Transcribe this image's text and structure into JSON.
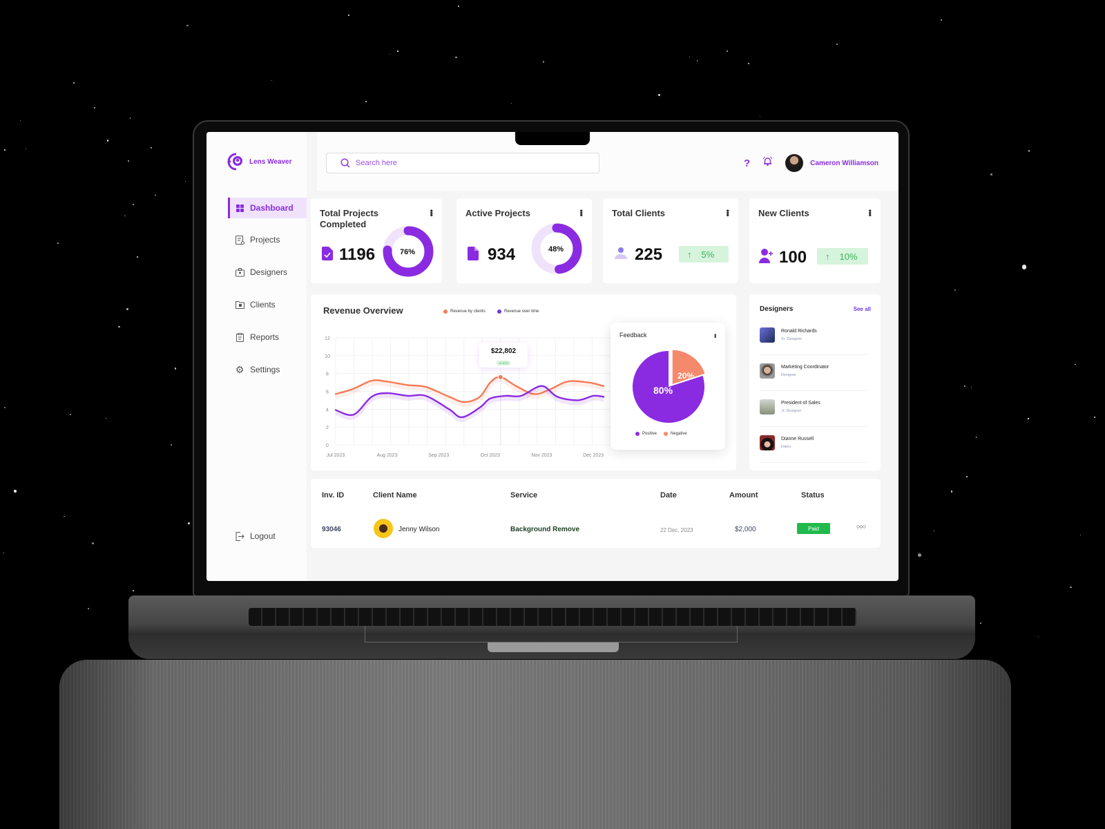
{
  "app": {
    "name": "Lens Weaver"
  },
  "header": {
    "search_placeholder": "Search here",
    "user_name": "Cameron Williamson",
    "help_icon": "question-icon",
    "notification_icon": "bell-icon"
  },
  "sidebar": {
    "items": [
      {
        "label": "Dashboard",
        "icon": "grid-icon",
        "active": true
      },
      {
        "label": "Projects",
        "icon": "checklist-icon",
        "active": false
      },
      {
        "label": "Designers",
        "icon": "id-badge-icon",
        "active": false
      },
      {
        "label": "Clients",
        "icon": "folder-user-icon",
        "active": false
      },
      {
        "label": "Reports",
        "icon": "clipboard-icon",
        "active": false
      },
      {
        "label": "Settings",
        "icon": "gear-icon",
        "active": false
      }
    ],
    "logout_label": "Logout"
  },
  "stats": [
    {
      "title": "Total Projects Completed",
      "title_line1": "Total Projects",
      "title_line2": "Completed",
      "value": "1196",
      "percent": 76,
      "percent_label": "76%"
    },
    {
      "title": "Active Projects",
      "value": "934",
      "percent": 48,
      "percent_label": "48%"
    },
    {
      "title": "Total Clients",
      "value": "225",
      "trend": "5%"
    },
    {
      "title": "New Clients",
      "value": "100",
      "trend": "10%"
    }
  ],
  "revenue": {
    "title": "Revenue Overview",
    "legend": [
      {
        "label": "Revenue by clients",
        "color": "#f47b57"
      },
      {
        "label": "Revenue over time",
        "color": "#6a3be0"
      }
    ],
    "tooltip": {
      "value": "$22,802",
      "badge": "11.87%"
    }
  },
  "chart_data": {
    "type": "line",
    "title": "Revenue Overview",
    "x": [
      "Jul 2023",
      "Aug 2023",
      "Sep 2023",
      "Oct 2023",
      "Nov 2023",
      "Dec 2023"
    ],
    "ylim": [
      0,
      12
    ],
    "yticks": [
      "0",
      "2",
      "4",
      "6",
      "8",
      "10",
      "12"
    ],
    "grid": true,
    "legend_position": "top",
    "series": [
      {
        "name": "Revenue by clients",
        "color": "#f47b57",
        "points": [
          [
            0,
            5.7
          ],
          [
            0.35,
            6.3
          ],
          [
            0.7,
            7.2
          ],
          [
            1.0,
            7.1
          ],
          [
            1.4,
            6.7
          ],
          [
            1.75,
            6.5
          ],
          [
            2.2,
            5.4
          ],
          [
            2.5,
            4.8
          ],
          [
            2.8,
            5.4
          ],
          [
            3.0,
            7.0
          ],
          [
            3.2,
            7.6
          ],
          [
            3.5,
            6.6
          ],
          [
            3.85,
            5.7
          ],
          [
            4.15,
            6.2
          ],
          [
            4.5,
            7.1
          ],
          [
            4.9,
            7.0
          ],
          [
            5.2,
            6.6
          ]
        ]
      },
      {
        "name": "Revenue over time",
        "color": "#8a2be2",
        "points": [
          [
            0,
            3.9
          ],
          [
            0.35,
            3.4
          ],
          [
            0.7,
            5.4
          ],
          [
            1.0,
            5.8
          ],
          [
            1.4,
            5.5
          ],
          [
            1.75,
            5.5
          ],
          [
            2.2,
            4.0
          ],
          [
            2.45,
            3.1
          ],
          [
            2.8,
            4.2
          ],
          [
            3.0,
            5.2
          ],
          [
            3.3,
            5.5
          ],
          [
            3.6,
            5.5
          ],
          [
            4.0,
            6.6
          ],
          [
            4.3,
            5.4
          ],
          [
            4.7,
            5.0
          ],
          [
            5.0,
            5.5
          ],
          [
            5.2,
            5.4
          ]
        ]
      }
    ],
    "highlight": {
      "series": "Revenue by clients",
      "x": 3.2,
      "label": "$22,802"
    }
  },
  "feedback": {
    "title": "Feedback",
    "chart_data": {
      "type": "pie",
      "slices": [
        {
          "label": "Positive",
          "value": 80,
          "color": "#8a2be2"
        },
        {
          "label": "Negative",
          "value": 20,
          "color": "#f4896b"
        }
      ]
    }
  },
  "designers": {
    "title": "Designers",
    "see_all": "See all",
    "items": [
      {
        "name": "Ronald Richards",
        "role": "Sr. Designer"
      },
      {
        "name": "Marketing Coordinator",
        "role": "Designer"
      },
      {
        "name": "President of Sales",
        "role": "Jr. Designer"
      },
      {
        "name": "Dianne Russell",
        "role": "Intern"
      }
    ]
  },
  "invoices": {
    "columns": [
      "Inv. ID",
      "Client Name",
      "Service",
      "Date",
      "Amount",
      "Status"
    ],
    "rows": [
      {
        "id": "93046",
        "client": "Jenny Wilson",
        "service": "Background Remove",
        "date": "22 Dec, 2023",
        "amount": "$2,000",
        "status": "Paid"
      }
    ]
  }
}
